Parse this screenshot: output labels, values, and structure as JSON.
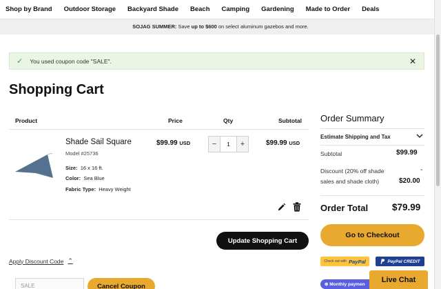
{
  "nav": {
    "items": [
      "Shop by Brand",
      "Outdoor Storage",
      "Backyard Shade",
      "Beach",
      "Camping",
      "Gardening",
      "Made to Order",
      "Deals"
    ]
  },
  "promo": {
    "brand": "SOJAG SUMMER:",
    "text_a": " Save ",
    "highlight": "up to $600",
    "text_b": " on select aluminum gazebos and more."
  },
  "alert": {
    "message": "You used coupon code \"SALE\"."
  },
  "cart": {
    "title": "Shopping Cart",
    "columns": {
      "product": "Product",
      "price": "Price",
      "qty": "Qty",
      "subtotal": "Subtotal"
    },
    "item": {
      "name": "Shade Sail Square",
      "model": "Model #25736",
      "attributes": [
        {
          "label": "Size:",
          "value": "16 x 16 ft."
        },
        {
          "label": "Color:",
          "value": "Sea Blue"
        },
        {
          "label": "Fabric Type:",
          "value": "Heavy Weight"
        }
      ],
      "price": "$99.99",
      "price_currency": "USD",
      "qty": "1",
      "subtotal": "$99.99",
      "subtotal_currency": "USD",
      "image_color": "#54728f"
    },
    "update_label": "Update Shopping Cart"
  },
  "discount": {
    "link_label": "Apply Discount Code",
    "input_placeholder": "SALE",
    "button_label": "Cancel Coupon"
  },
  "summary": {
    "title": "Order Summary",
    "estimate_label": "Estimate Shipping and Tax",
    "subtotal_label": "Subtotal",
    "subtotal_value": "$99.99",
    "discount_label": "Discount (20% off shade sales and shade cloth)",
    "discount_sign": "-",
    "discount_value": "$20.00",
    "total_label": "Order Total",
    "total_value": "$79.99",
    "checkout_label": "Go to Checkout"
  },
  "payments": {
    "paypal_later_small": "Check out with",
    "paypal_later_brand": "PayPal",
    "paypal_credit": "PayPal CREDIT",
    "monthly": "Monthly paymen"
  },
  "chat": {
    "label": "Live Chat"
  },
  "colors": {
    "accent": "#e8a92e",
    "dark": "#111111",
    "success_bg": "#eaf5e3",
    "paypal_blue": "#1f3f93"
  }
}
